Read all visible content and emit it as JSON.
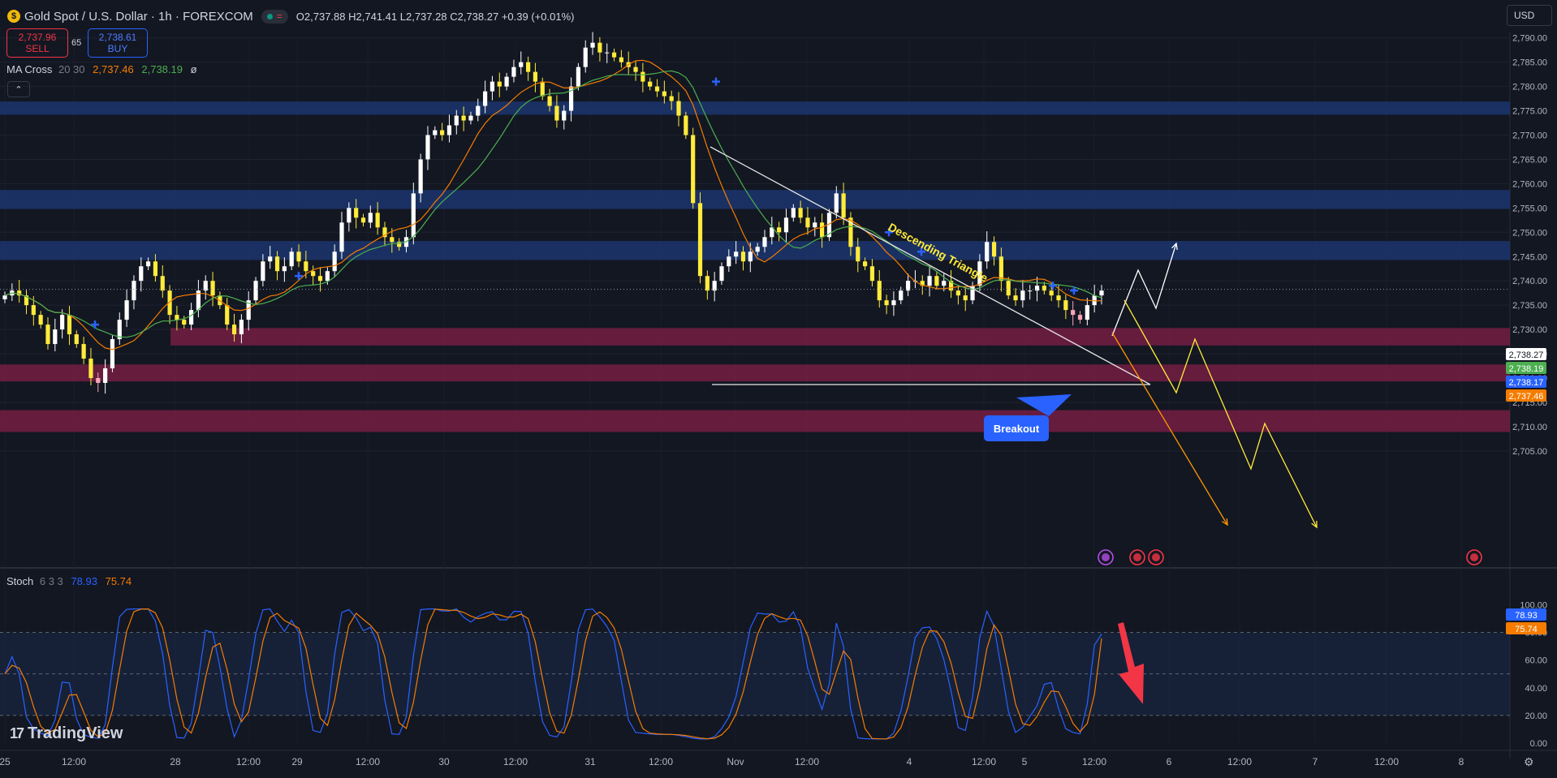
{
  "header": {
    "title": "Gold Spot / U.S. Dollar · 1h · FOREXCOM",
    "ohlc": {
      "o_label": "O",
      "o": "2,737.88",
      "h_label": "H",
      "h": "2,741.41",
      "l_label": "L",
      "l": "2,737.28",
      "c_label": "C",
      "c": "2,738.27",
      "change": "+0.39 (+0.01%)"
    },
    "sell_price": "2,737.96",
    "sell_label": "SELL",
    "buy_price": "2,738.61",
    "buy_label": "BUY",
    "spread": "65",
    "currency": "USD"
  },
  "indicators": {
    "ma": {
      "name": "MA Cross",
      "params": "20 30",
      "fast": "2,737.46",
      "slow": "2,738.19",
      "extra": "ø"
    },
    "stoch": {
      "name": "Stoch",
      "params": "6 3 3",
      "k": "78.93",
      "d": "75.74"
    }
  },
  "branding": {
    "logo_text": "TradingView",
    "logo_mark": "17"
  },
  "colors": {
    "background": "#131722",
    "up_candle": "#ffffff",
    "down_candle": "#ffeb3b",
    "down_candle_faded": "#f8a5b8",
    "ma_fast": "#f57c00",
    "ma_slow": "#4caf50",
    "stoch_k": "#2962ff",
    "stoch_d": "#f57c00",
    "supply_zone": "#1e3a78",
    "demand_zone": "#7a1e45",
    "arrow_yellow": "#ffeb3b",
    "arrow_orange": "#ff9800",
    "callout": "#2962ff",
    "stoch_arrow": "#f23645"
  },
  "chart_data": [
    {
      "type": "candlestick",
      "title": "Gold Spot / U.S. Dollar · 1h · FOREXCOM",
      "grid": true,
      "ylim": [
        2702,
        2797
      ],
      "y_ticks": [
        "2,705.00",
        "2,710.00",
        "2,715.00",
        "2,720.00",
        "2,725.00",
        "2,730.00",
        "2,735.00",
        "2,740.00",
        "2,745.00",
        "2,750.00",
        "2,755.00",
        "2,760.00",
        "2,765.00",
        "2,770.00",
        "2,775.00",
        "2,780.00",
        "2,785.00",
        "2,790.00"
      ],
      "y_tick_values": [
        2705,
        2710,
        2715,
        2720,
        2725,
        2730,
        2735,
        2740,
        2745,
        2750,
        2755,
        2760,
        2765,
        2770,
        2775,
        2780,
        2785,
        2790
      ],
      "x_ticks": [
        "25",
        "12:00",
        "28",
        "12:00",
        "29",
        "12:00",
        "30",
        "12:00",
        "31",
        "12:00",
        "Nov",
        "12:00",
        "4",
        "12:00",
        "5",
        "12:00",
        "6",
        "12:00",
        "7",
        "12:00",
        "8"
      ],
      "price_labels": [
        {
          "text": "2,738.27",
          "value": 2738.27,
          "color": "#ffffff",
          "text_color": "#131722"
        },
        {
          "text": "2,738.19",
          "value": 2738.19,
          "color": "#4caf50",
          "text_color": "#ffffff"
        },
        {
          "text": "2,738.17",
          "value": 2738.17,
          "color": "#2962ff",
          "text_color": "#ffffff"
        },
        {
          "text": "2,737.46",
          "value": 2737.46,
          "color": "#f57c00",
          "text_color": "#ffffff"
        }
      ],
      "supply_zones": [
        [
          2774.2,
          2776.9
        ],
        [
          2754.8,
          2758.7
        ],
        [
          2744.3,
          2748.2
        ]
      ],
      "demand_zones": [
        [
          2726.7,
          2730.3
        ],
        [
          2719.3,
          2722.8
        ],
        [
          2708.9,
          2713.4
        ]
      ],
      "annotations": [
        "Descending Triangle",
        "Breakout"
      ],
      "close_path": [
        2737,
        2738,
        2737,
        2735,
        2733,
        2731,
        2727,
        2730,
        2733,
        2729,
        2727,
        2724,
        2720,
        2719,
        2722,
        2728,
        2732,
        2736,
        2740,
        2743,
        2744,
        2741,
        2738,
        2733,
        2732,
        2731,
        2734,
        2738,
        2740,
        2737,
        2735,
        2731,
        2729,
        2732,
        2736,
        2740,
        2744,
        2745,
        2742,
        2743,
        2746,
        2744,
        2742,
        2741,
        2740,
        2742,
        2746,
        2752,
        2755,
        2753,
        2752,
        2754,
        2751,
        2749,
        2748,
        2747,
        2749,
        2758,
        2765,
        2770,
        2771,
        2770,
        2772,
        2774,
        2773,
        2774,
        2776,
        2779,
        2781,
        2780,
        2782,
        2784,
        2785,
        2783,
        2781,
        2778,
        2776,
        2773,
        2775,
        2780,
        2784,
        2788,
        2789,
        2787,
        2787,
        2786,
        2785,
        2784,
        2783,
        2781,
        2780,
        2779,
        2778,
        2777,
        2774,
        2770,
        2756,
        2741,
        2738,
        2740,
        2743,
        2745,
        2746,
        2744,
        2746,
        2747,
        2749,
        2751,
        2750,
        2753,
        2755,
        2753,
        2751,
        2752,
        2749,
        2754,
        2758,
        2753,
        2747,
        2744,
        2743,
        2740,
        2736,
        2735,
        2736,
        2738,
        2740,
        2740,
        2739,
        2741,
        2739,
        2740,
        2738,
        2737,
        2736,
        2739,
        2744,
        2748,
        2745,
        2740,
        2737,
        2736,
        2738,
        2738,
        2739,
        2738,
        2737,
        2736,
        2734,
        2733,
        2732,
        2735,
        2737,
        2738
      ]
    },
    {
      "type": "line",
      "title": "Stoch 6 3 3",
      "ylim": [
        0,
        100
      ],
      "y_ticks": [
        "0.00",
        "20.00",
        "40.00",
        "60.00",
        "80.00",
        "100.00"
      ],
      "y_tick_values": [
        0,
        20,
        40,
        60,
        80,
        100
      ],
      "dashed_levels": [
        80,
        50,
        20
      ],
      "series": [
        {
          "name": "%K",
          "color": "#2962ff",
          "last": 78.93
        },
        {
          "name": "%D",
          "color": "#f57c00",
          "last": 75.74
        }
      ]
    }
  ]
}
